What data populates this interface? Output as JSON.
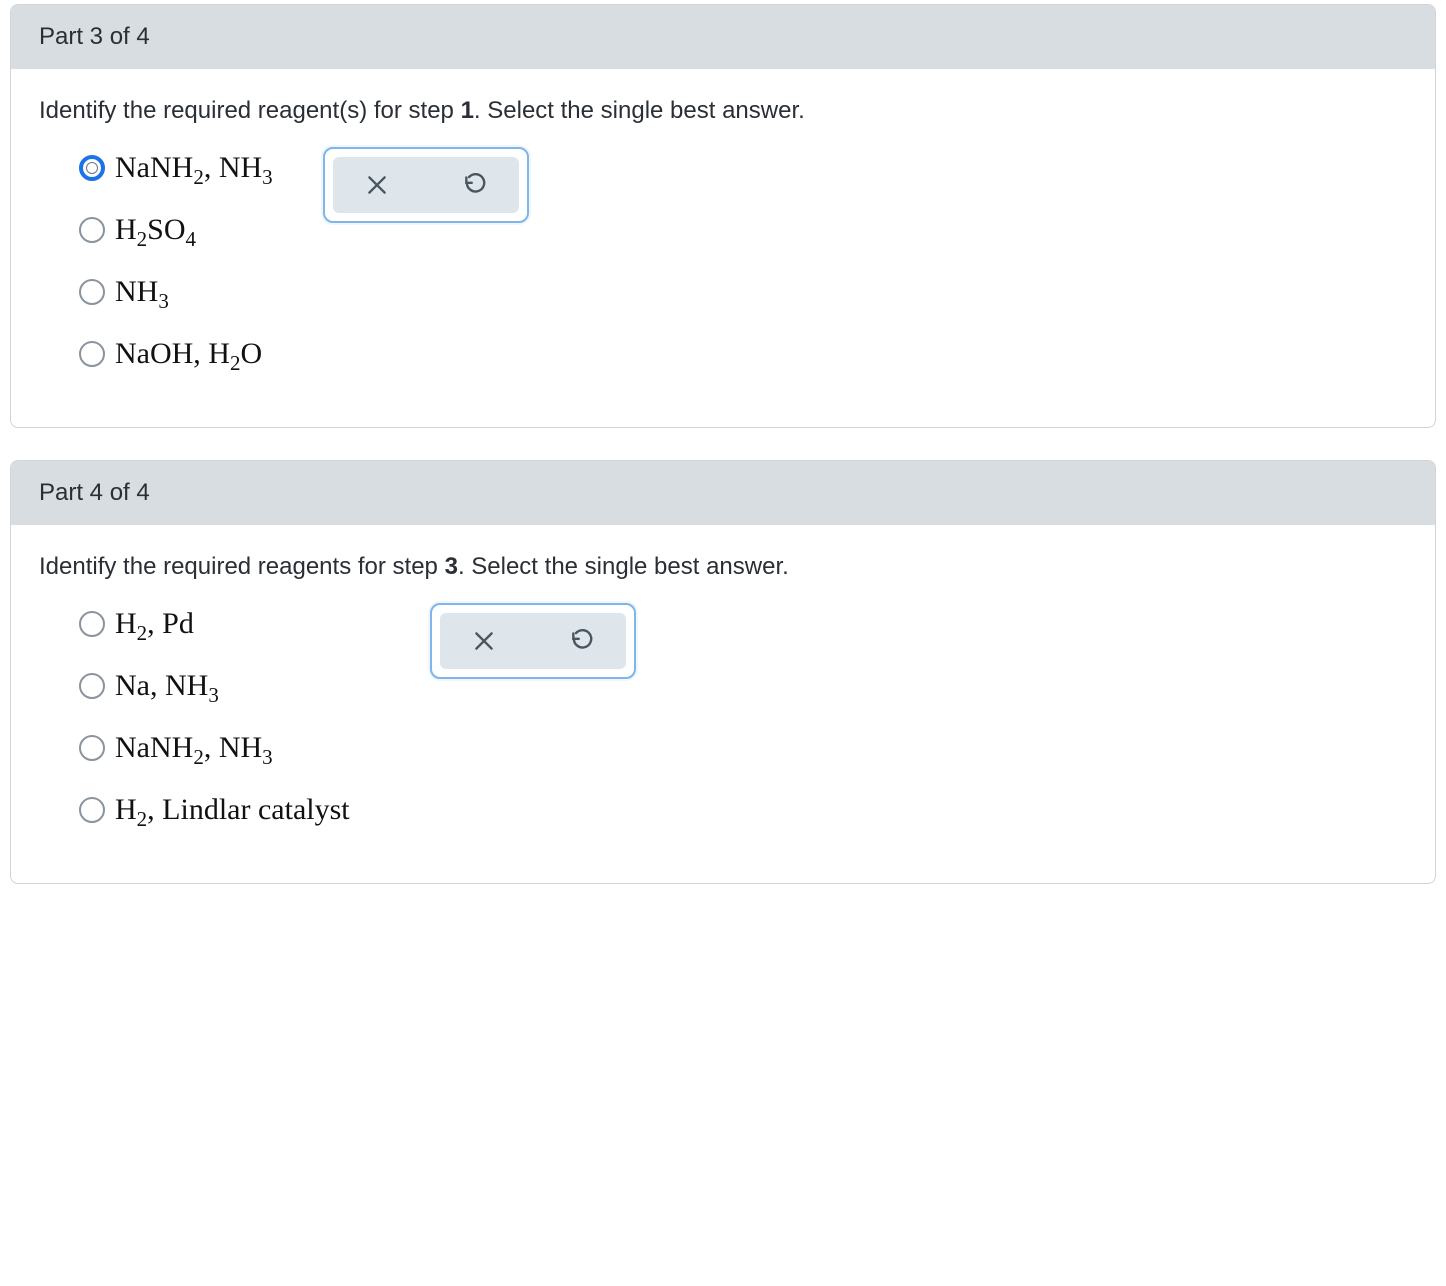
{
  "part3": {
    "header": "Part 3 of 4",
    "question_prefix": "Identify the required reagent(s) for step ",
    "question_step": "1",
    "question_suffix": ". Select the single best answer.",
    "options": [
      {
        "formula": "NaNH<sub>2</sub>, NH<sub>3</sub>",
        "selected": true
      },
      {
        "formula": "H<sub>2</sub>SO<sub>4</sub>",
        "selected": false
      },
      {
        "formula": "NH<sub>3</sub>",
        "selected": false
      },
      {
        "formula": "NaOH, H<sub>2</sub>O",
        "selected": false
      }
    ]
  },
  "part4": {
    "header": "Part 4 of 4",
    "question_prefix": "Identify the required reagents for step ",
    "question_step": "3",
    "question_suffix": ". Select the single best answer.",
    "options": [
      {
        "formula": "H<sub>2</sub>, Pd",
        "selected": false
      },
      {
        "formula": "Na, NH<sub>3</sub>",
        "selected": false
      },
      {
        "formula": "NaNH<sub>2</sub>, NH<sub>3</sub>",
        "selected": false
      },
      {
        "formula": "H<sub>2</sub>, Lindlar catalyst",
        "selected": false
      }
    ]
  },
  "icons": {
    "close": "close-icon",
    "reset": "reset-icon"
  }
}
